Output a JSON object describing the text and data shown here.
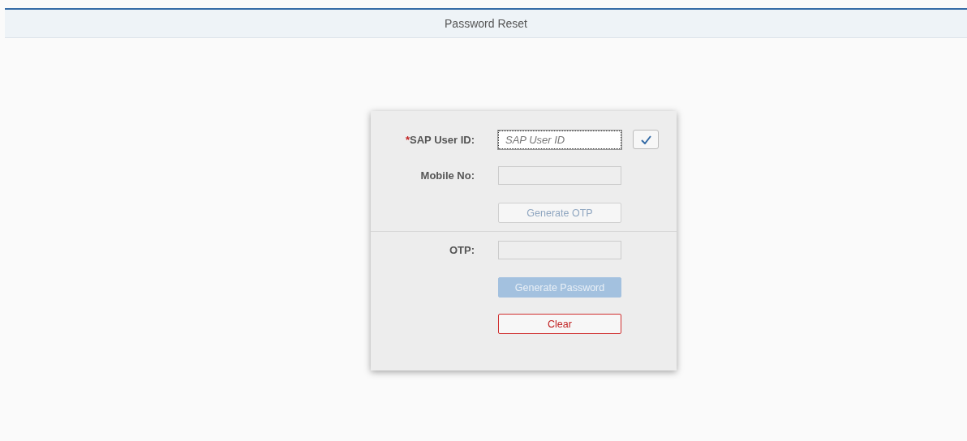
{
  "header": {
    "title": "Password Reset"
  },
  "form": {
    "sections": [
      {
        "rows": [
          {
            "kind": "field",
            "required_mark": "*",
            "label": "SAP User ID:",
            "placeholder": "SAP User ID",
            "focused": true,
            "disabled": false,
            "action": {
              "kind": "check"
            }
          },
          {
            "kind": "field",
            "label": "Mobile No:",
            "disabled": true
          },
          {
            "kind": "button",
            "text": "Generate OTP",
            "disabled": true
          }
        ]
      },
      {
        "rows": [
          {
            "kind": "field",
            "label": "OTP:",
            "disabled": true
          },
          {
            "kind": "primary-button",
            "text": "Generate Password",
            "disabled": true
          },
          {
            "kind": "reject-button",
            "text": "Clear",
            "disabled": false
          }
        ]
      }
    ]
  }
}
